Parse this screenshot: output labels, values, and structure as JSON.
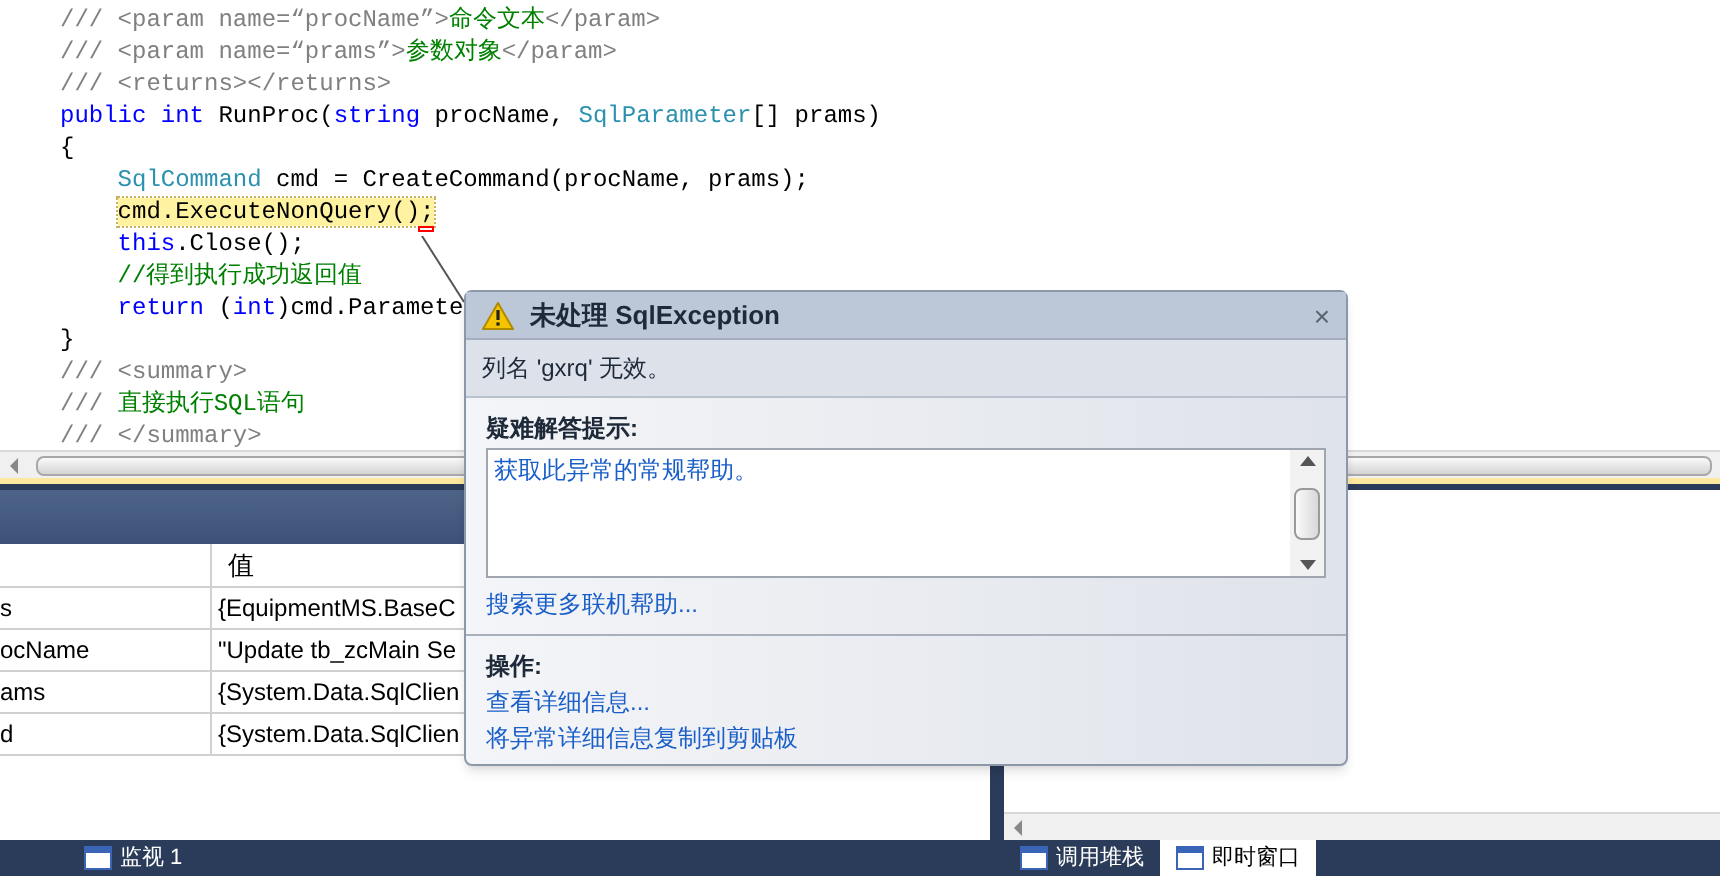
{
  "editor": {
    "lines": [
      {
        "segments": [
          {
            "kind": "doc",
            "text": "/// <param name=“procName”>"
          },
          {
            "kind": "comment",
            "text": "命令文本"
          },
          {
            "kind": "doc",
            "text": "</param>"
          }
        ]
      },
      {
        "segments": [
          {
            "kind": "doc",
            "text": "/// <param name=“prams”>"
          },
          {
            "kind": "comment",
            "text": "参数对象"
          },
          {
            "kind": "doc",
            "text": "</param>"
          }
        ]
      },
      {
        "segments": [
          {
            "kind": "doc",
            "text": "/// <returns></returns>"
          }
        ]
      },
      {
        "segments": [
          {
            "kind": "keyword",
            "text": "public int"
          },
          {
            "kind": "plain",
            "text": " RunProc("
          },
          {
            "kind": "keyword",
            "text": "string"
          },
          {
            "kind": "plain",
            "text": " procName, "
          },
          {
            "kind": "type",
            "text": "SqlParameter"
          },
          {
            "kind": "plain",
            "text": "[] prams)"
          }
        ]
      },
      {
        "segments": [
          {
            "kind": "plain",
            "text": "{"
          }
        ]
      },
      {
        "indent": true,
        "segments": [
          {
            "kind": "type",
            "text": "SqlCommand"
          },
          {
            "kind": "plain",
            "text": " cmd = CreateCommand(procName, prams);"
          }
        ]
      },
      {
        "indent": true,
        "segments": [
          {
            "kind": "current",
            "text": "cmd.ExecuteNonQuery();"
          }
        ]
      },
      {
        "indent": true,
        "segments": [
          {
            "kind": "keyword",
            "text": "this"
          },
          {
            "kind": "plain",
            "text": ".Close();"
          }
        ]
      },
      {
        "indent": true,
        "segments": [
          {
            "kind": "comment",
            "text": "//得到执行成功返回值"
          }
        ]
      },
      {
        "indent": true,
        "segments": [
          {
            "kind": "keyword",
            "text": "return"
          },
          {
            "kind": "plain",
            "text": " ("
          },
          {
            "kind": "keyword",
            "text": "int"
          },
          {
            "kind": "plain",
            "text": ")cmd.Paramete"
          }
        ]
      },
      {
        "segments": [
          {
            "kind": "plain",
            "text": "}"
          }
        ]
      },
      {
        "segments": [
          {
            "kind": "doc",
            "text": "/// <summary>"
          }
        ]
      },
      {
        "segments": [
          {
            "kind": "doc",
            "text": "/// "
          },
          {
            "kind": "comment",
            "text": "直接执行SQL语句"
          }
        ]
      },
      {
        "segments": [
          {
            "kind": "doc",
            "text": "/// </summary>"
          }
        ]
      }
    ]
  },
  "locals": {
    "value_header": "值",
    "rows": [
      {
        "name": "s",
        "value": "{EquipmentMS.BaseC"
      },
      {
        "name": "ocName",
        "value": "\"Update tb_zcMain Se"
      },
      {
        "name": "ams",
        "value": "{System.Data.SqlClien"
      },
      {
        "name": "d",
        "value": "{System.Data.SqlClien"
      }
    ]
  },
  "exception_popup": {
    "title_prefix": "未处理",
    "title": "SqlException",
    "close_glyph": "×",
    "message": "列名 'gxrq' 无效。",
    "tips_heading": "疑难解答提示:",
    "tips": [
      "获取此异常的常规帮助。"
    ],
    "search_link": "搜索更多联机帮助...",
    "actions_heading": "操作:",
    "actions": [
      "查看详细信息...",
      "将异常详细信息复制到剪贴板"
    ]
  },
  "bottom_tabs_left": [
    {
      "label": "监视 1",
      "selected": false
    }
  ],
  "bottom_tabs_right": [
    {
      "label": "调用堆栈",
      "selected": false
    },
    {
      "label": "即时窗口",
      "selected": true
    }
  ]
}
